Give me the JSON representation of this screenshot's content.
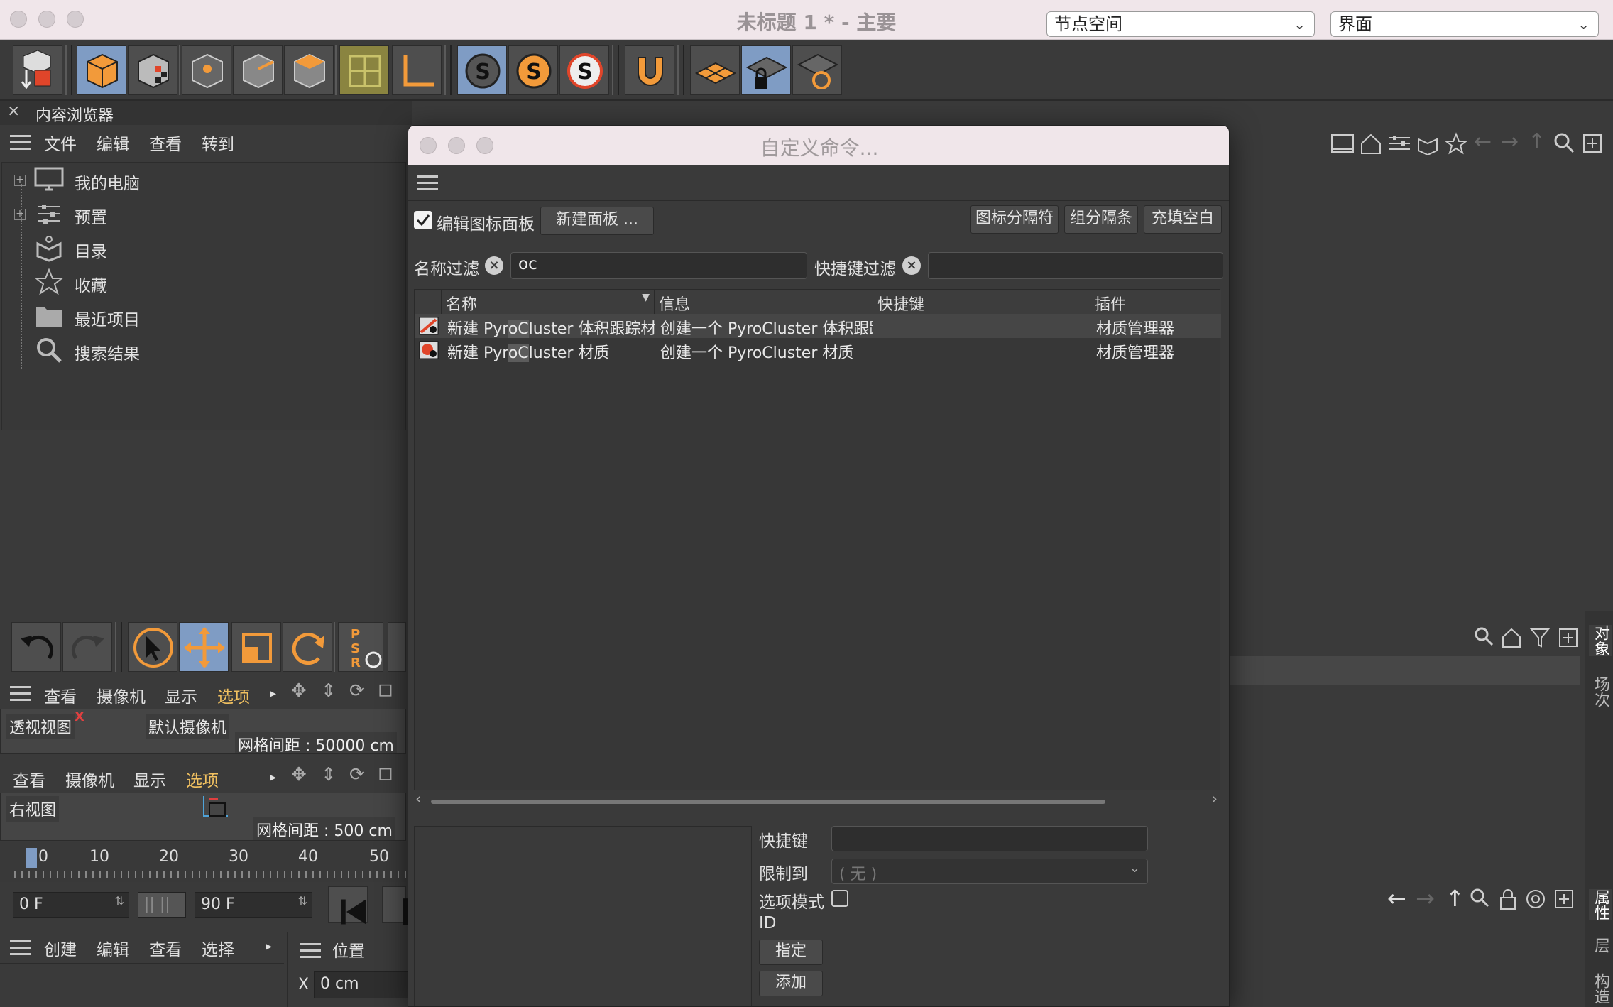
{
  "app": {
    "title": "未标题 1 * - 主要",
    "node_space": "节点空间",
    "layout": "界面"
  },
  "content_browser": {
    "tab_label": "内容浏览器",
    "menu": [
      "文件",
      "编辑",
      "查看",
      "转到"
    ],
    "tree": [
      {
        "label": "我的电脑",
        "icon": "computer-icon",
        "expandable": true
      },
      {
        "label": "预置",
        "icon": "sliders-icon",
        "expandable": true
      },
      {
        "label": "目录",
        "icon": "book-icon",
        "expandable": false
      },
      {
        "label": "收藏",
        "icon": "star-icon",
        "expandable": false
      },
      {
        "label": "最近项目",
        "icon": "folder-icon",
        "expandable": false
      },
      {
        "label": "搜索结果",
        "icon": "search-icon",
        "expandable": false
      }
    ]
  },
  "viewport1": {
    "menu": [
      "查看",
      "摄像机",
      "显示",
      "选项"
    ],
    "selected": "选项",
    "view_name": "透视视图",
    "camera": "默认摄像机",
    "grid": "网格间距 : 50000 cm"
  },
  "viewport2": {
    "menu": [
      "查看",
      "摄像机",
      "显示",
      "选项"
    ],
    "selected": "选项",
    "view_name": "右视图",
    "grid": "网格间距 : 500 cm"
  },
  "timeline": {
    "ticks": [
      "0",
      "10",
      "20",
      "30",
      "40",
      "50"
    ],
    "start_frame": "0 F",
    "end_frame": "90 F"
  },
  "bottom": {
    "menu": [
      "创建",
      "编辑",
      "查看",
      "选择"
    ],
    "position_label": "位置",
    "x_label": "X",
    "x_value": "0 cm"
  },
  "side_tabs": [
    "对象",
    "场次",
    "属性",
    "层",
    "构造"
  ],
  "dialog": {
    "title": "自定义命令...",
    "edit_palette_label": "编辑图标面板",
    "edit_palette_checked": true,
    "new_palette": "新建面板 ...",
    "icon_separator": "图标分隔符",
    "group_separator": "组分隔条",
    "fill_space": "充填空白",
    "name_filter_label": "名称过滤",
    "name_filter_value": "oc",
    "shortcut_filter_label": "快捷键过滤",
    "shortcut_filter_value": "",
    "columns": [
      "名称",
      "信息",
      "快捷键",
      "插件"
    ],
    "rows": [
      {
        "name_pre": "新建 Pyr",
        "name_hl": "oC",
        "name_post": "luster 体积跟踪材质",
        "info": "创建一个 PyroCluster 体积跟踪材质",
        "shortcut": "",
        "plugin": "材质管理器"
      },
      {
        "name_pre": "新建 Pyr",
        "name_hl": "oC",
        "name_post": "luster 材质",
        "info": "创建一个 PyroCluster 材质",
        "shortcut": "",
        "plugin": "材质管理器"
      }
    ],
    "shortcut_label": "快捷键",
    "restrict_label": "限制到",
    "restrict_value": "( 无 )",
    "option_mode_label": "选项模式",
    "id_label": "ID",
    "assign_button": "指定",
    "add_button": "添加"
  }
}
